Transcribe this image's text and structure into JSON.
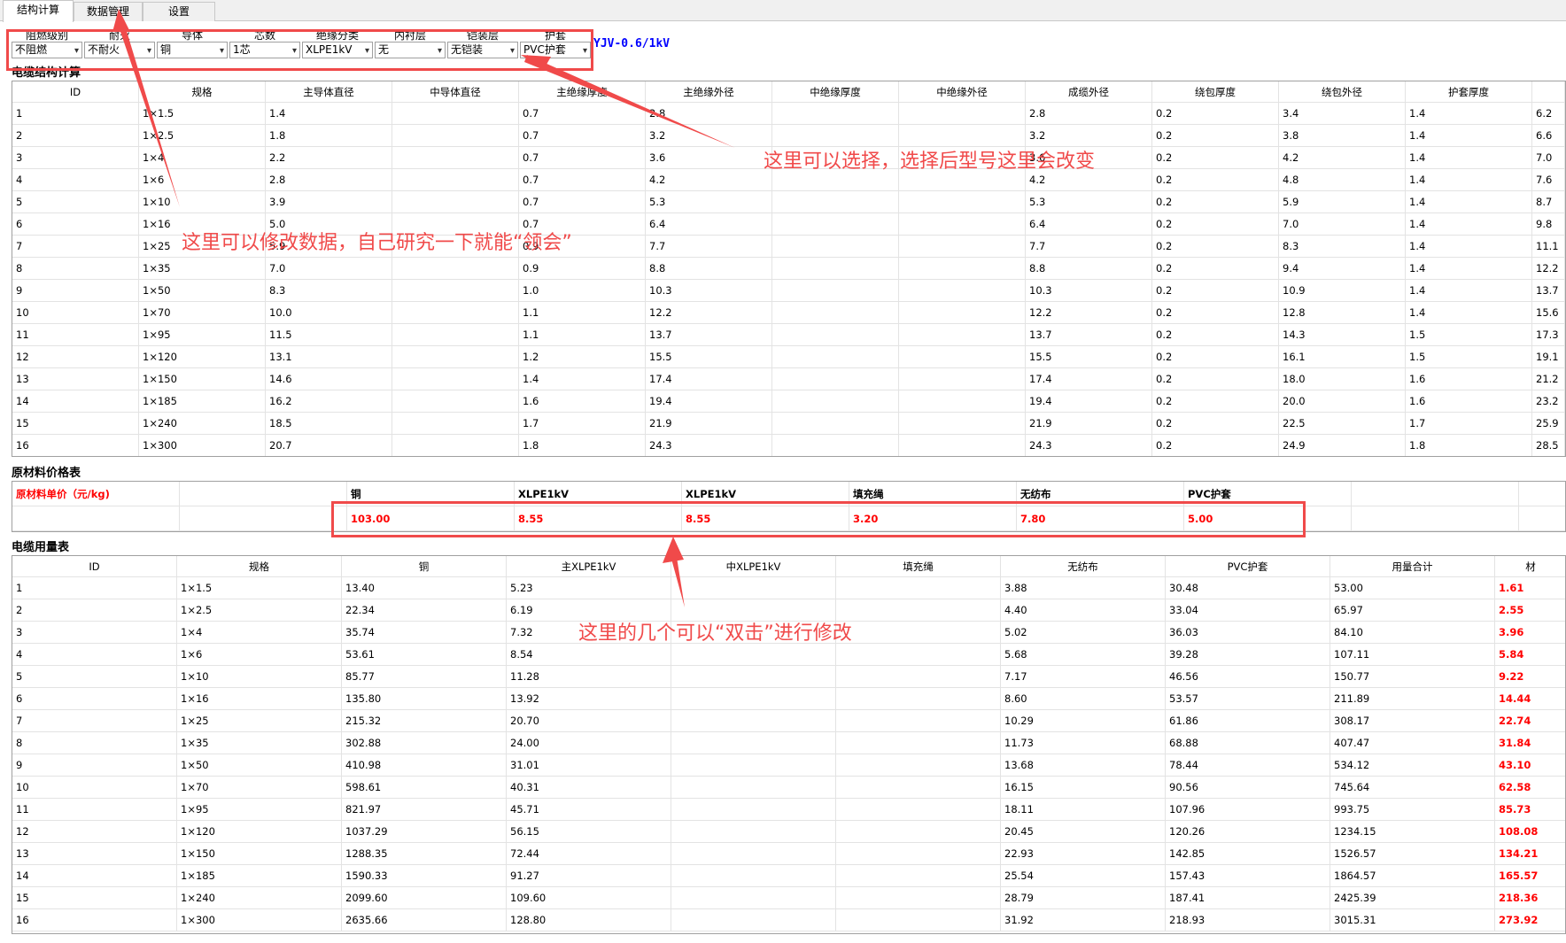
{
  "tabs": [
    "结构计算",
    "数据管理",
    "设置"
  ],
  "filters": [
    {
      "label": "阻燃级别",
      "value": "不阻燃"
    },
    {
      "label": "耐火",
      "value": "不耐火"
    },
    {
      "label": "导体",
      "value": "铜"
    },
    {
      "label": "芯数",
      "value": "1芯"
    },
    {
      "label": "绝缘分类",
      "value": "XLPE1kV"
    },
    {
      "label": "内衬层",
      "value": "无"
    },
    {
      "label": "铠装层",
      "value": "无铠装"
    },
    {
      "label": "护套",
      "value": "PVC护套"
    }
  ],
  "model": "YJV-0.6/1kV",
  "structure": {
    "title": "电缆结构计算",
    "headers": [
      "ID",
      "规格",
      "主导体直径",
      "中导体直径",
      "主绝缘厚度",
      "主绝缘外径",
      "中绝缘厚度",
      "中绝缘外径",
      "成缆外径",
      "绕包厚度",
      "绕包外径",
      "护套厚度",
      ""
    ],
    "rows": [
      [
        "1",
        "1×1.5",
        "1.4",
        "",
        "0.7",
        "2.8",
        "",
        "",
        "2.8",
        "0.2",
        "3.4",
        "1.4",
        "6.2"
      ],
      [
        "2",
        "1×2.5",
        "1.8",
        "",
        "0.7",
        "3.2",
        "",
        "",
        "3.2",
        "0.2",
        "3.8",
        "1.4",
        "6.6"
      ],
      [
        "3",
        "1×4",
        "2.2",
        "",
        "0.7",
        "3.6",
        "",
        "",
        "3.6",
        "0.2",
        "4.2",
        "1.4",
        "7.0"
      ],
      [
        "4",
        "1×6",
        "2.8",
        "",
        "0.7",
        "4.2",
        "",
        "",
        "4.2",
        "0.2",
        "4.8",
        "1.4",
        "7.6"
      ],
      [
        "5",
        "1×10",
        "3.9",
        "",
        "0.7",
        "5.3",
        "",
        "",
        "5.3",
        "0.2",
        "5.9",
        "1.4",
        "8.7"
      ],
      [
        "6",
        "1×16",
        "5.0",
        "",
        "0.7",
        "6.4",
        "",
        "",
        "6.4",
        "0.2",
        "7.0",
        "1.4",
        "9.8"
      ],
      [
        "7",
        "1×25",
        "5.9",
        "",
        "0.9",
        "7.7",
        "",
        "",
        "7.7",
        "0.2",
        "8.3",
        "1.4",
        "11.1"
      ],
      [
        "8",
        "1×35",
        "7.0",
        "",
        "0.9",
        "8.8",
        "",
        "",
        "8.8",
        "0.2",
        "9.4",
        "1.4",
        "12.2"
      ],
      [
        "9",
        "1×50",
        "8.3",
        "",
        "1.0",
        "10.3",
        "",
        "",
        "10.3",
        "0.2",
        "10.9",
        "1.4",
        "13.7"
      ],
      [
        "10",
        "1×70",
        "10.0",
        "",
        "1.1",
        "12.2",
        "",
        "",
        "12.2",
        "0.2",
        "12.8",
        "1.4",
        "15.6"
      ],
      [
        "11",
        "1×95",
        "11.5",
        "",
        "1.1",
        "13.7",
        "",
        "",
        "13.7",
        "0.2",
        "14.3",
        "1.5",
        "17.3"
      ],
      [
        "12",
        "1×120",
        "13.1",
        "",
        "1.2",
        "15.5",
        "",
        "",
        "15.5",
        "0.2",
        "16.1",
        "1.5",
        "19.1"
      ],
      [
        "13",
        "1×150",
        "14.6",
        "",
        "1.4",
        "17.4",
        "",
        "",
        "17.4",
        "0.2",
        "18.0",
        "1.6",
        "21.2"
      ],
      [
        "14",
        "1×185",
        "16.2",
        "",
        "1.6",
        "19.4",
        "",
        "",
        "19.4",
        "0.2",
        "20.0",
        "1.6",
        "23.2"
      ],
      [
        "15",
        "1×240",
        "18.5",
        "",
        "1.7",
        "21.9",
        "",
        "",
        "21.9",
        "0.2",
        "22.5",
        "1.7",
        "25.9"
      ],
      [
        "16",
        "1×300",
        "20.7",
        "",
        "1.8",
        "24.3",
        "",
        "",
        "24.3",
        "0.2",
        "24.9",
        "1.8",
        "28.5"
      ]
    ]
  },
  "prices": {
    "title": "原材料价格表",
    "label": "原材料单价（元/kg)",
    "headers": [
      "铜",
      "XLPE1kV",
      "XLPE1kV",
      "填充绳",
      "无纺布",
      "PVC护套"
    ],
    "values": [
      "103.00",
      "8.55",
      "8.55",
      "3.20",
      "7.80",
      "5.00"
    ]
  },
  "usage": {
    "title": "电缆用量表",
    "headers": [
      "ID",
      "规格",
      "铜",
      "主XLPE1kV",
      "中XLPE1kV",
      "填充绳",
      "无纺布",
      "PVC护套",
      "用量合计",
      "材"
    ],
    "rows": [
      [
        "1",
        "1×1.5",
        "13.40",
        "5.23",
        "",
        "",
        "3.88",
        "30.48",
        "53.00",
        "1.61"
      ],
      [
        "2",
        "1×2.5",
        "22.34",
        "6.19",
        "",
        "",
        "4.40",
        "33.04",
        "65.97",
        "2.55"
      ],
      [
        "3",
        "1×4",
        "35.74",
        "7.32",
        "",
        "",
        "5.02",
        "36.03",
        "84.10",
        "3.96"
      ],
      [
        "4",
        "1×6",
        "53.61",
        "8.54",
        "",
        "",
        "5.68",
        "39.28",
        "107.11",
        "5.84"
      ],
      [
        "5",
        "1×10",
        "85.77",
        "11.28",
        "",
        "",
        "7.17",
        "46.56",
        "150.77",
        "9.22"
      ],
      [
        "6",
        "1×16",
        "135.80",
        "13.92",
        "",
        "",
        "8.60",
        "53.57",
        "211.89",
        "14.44"
      ],
      [
        "7",
        "1×25",
        "215.32",
        "20.70",
        "",
        "",
        "10.29",
        "61.86",
        "308.17",
        "22.74"
      ],
      [
        "8",
        "1×35",
        "302.88",
        "24.00",
        "",
        "",
        "11.73",
        "68.88",
        "407.47",
        "31.84"
      ],
      [
        "9",
        "1×50",
        "410.98",
        "31.01",
        "",
        "",
        "13.68",
        "78.44",
        "534.12",
        "43.10"
      ],
      [
        "10",
        "1×70",
        "598.61",
        "40.31",
        "",
        "",
        "16.15",
        "90.56",
        "745.64",
        "62.58"
      ],
      [
        "11",
        "1×95",
        "821.97",
        "45.71",
        "",
        "",
        "18.11",
        "107.96",
        "993.75",
        "85.73"
      ],
      [
        "12",
        "1×120",
        "1037.29",
        "56.15",
        "",
        "",
        "20.45",
        "120.26",
        "1234.15",
        "108.08"
      ],
      [
        "13",
        "1×150",
        "1288.35",
        "72.44",
        "",
        "",
        "22.93",
        "142.85",
        "1526.57",
        "134.21"
      ],
      [
        "14",
        "1×185",
        "1590.33",
        "91.27",
        "",
        "",
        "25.54",
        "157.43",
        "1864.57",
        "165.57"
      ],
      [
        "15",
        "1×240",
        "2099.60",
        "109.60",
        "",
        "",
        "28.79",
        "187.41",
        "2425.39",
        "218.36"
      ],
      [
        "16",
        "1×300",
        "2635.66",
        "128.80",
        "",
        "",
        "31.92",
        "218.93",
        "3015.31",
        "273.92"
      ]
    ]
  },
  "annotations": {
    "select_note": "这里可以选择，选择后型号这里会改变",
    "modify_note": "这里可以修改数据，自己研究一下就能“领会”",
    "dblclick_note": "这里的几个可以“双击”进行修改",
    "color": "#f04a4a"
  }
}
